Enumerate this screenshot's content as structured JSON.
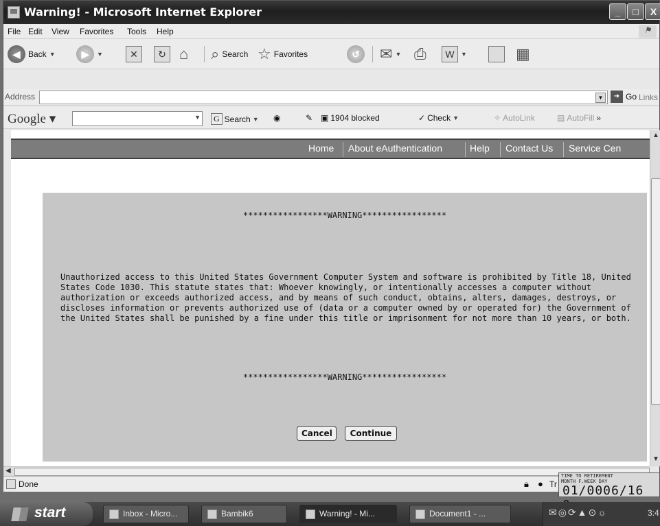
{
  "window": {
    "title": "Warning! - Microsoft Internet Explorer",
    "buttons": {
      "minimize": "_",
      "maximize": "□",
      "close": "X"
    }
  },
  "menubar": [
    "File",
    "Edit",
    "View",
    "Favorites",
    "Tools",
    "Help"
  ],
  "toolbar": {
    "back_label": "Back",
    "search_label": "Search",
    "favorites_label": "Favorites"
  },
  "address_bar": {
    "label": "Address",
    "value": "",
    "go_label": "Go",
    "links_label": "Links"
  },
  "google_toolbar": {
    "logo": "Google",
    "search_value": "",
    "search_label": "Search",
    "blocked_label": "1904 blocked",
    "check_label": "Check",
    "autolink_label": "AutoLink",
    "autofill_label": "AutoFill"
  },
  "site_nav": [
    "Home",
    "About eAuthentication",
    "Help",
    "Contact Us",
    "Service Cen"
  ],
  "warning": {
    "banner_top": "*****************WARNING*****************",
    "body": "Unauthorized access to this United States Government Computer System and software is prohibited by Title 18, United States Code 1030. This statute states that: Whoever knowingly, or intentionally accesses a computer without authorization or exceeds authorized access, and by means of such conduct, obtains, alters, damages, destroys, or discloses information or prevents authorized use of (data or a computer owned by or operated for) the Government of the United States shall be punished by a fine under this title or imprisonment for not more than 10 years, or both.",
    "banner_bottom": "*****************WARNING*****************",
    "cancel_label": "Cancel",
    "continue_label": "Continue"
  },
  "statusbar": {
    "text": "Done",
    "zone_text": "Tr"
  },
  "retirement_widget": {
    "line1": "TIME TO RETIREMENT",
    "line2": "MONTH  F.WEEK   DAY",
    "value": "01/0006/16 0"
  },
  "taskbar": {
    "start_label": "start",
    "tasks": [
      "Inbox - Micro...",
      "Bambik6",
      "Warning! - Mi...",
      "Document1 - ..."
    ],
    "clock": "3:4"
  },
  "colors": {
    "title_bar": "#2a2a2a",
    "nav_strip": "#7c7c7c",
    "warning_panel": "#c6c6c6",
    "taskbar": "#3a3a3a"
  }
}
